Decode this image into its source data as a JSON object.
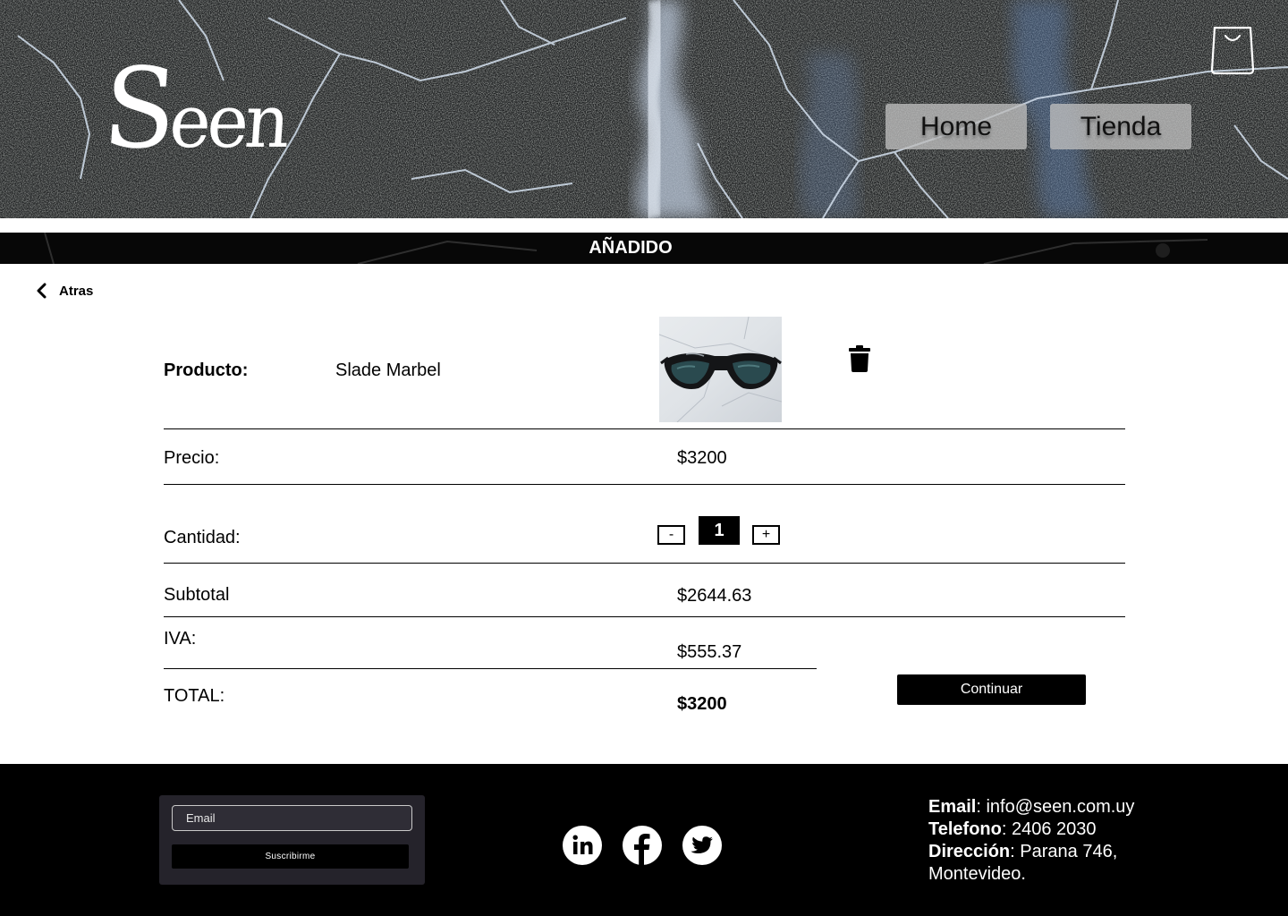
{
  "header": {
    "logo": {
      "big": "S",
      "rest": "een"
    },
    "nav": {
      "home": "Home",
      "tienda": "Tienda"
    },
    "cart_icon": "shopping-bag-icon"
  },
  "banner": {
    "text": "AÑADIDO"
  },
  "back": {
    "label": "Atras",
    "icon": "chevron-left-icon"
  },
  "cart": {
    "product_label": "Producto:",
    "product_name": "Slade Marbel",
    "product_image": "sunglasses on marble",
    "delete_icon": "trash-icon",
    "price_label": "Precio:",
    "price_value": "$3200",
    "quantity_label": "Cantidad:",
    "quantity_minus": "-",
    "quantity_value": "1",
    "quantity_plus": "+",
    "subtotal_label": "Subtotal",
    "subtotal_value": "$2644.63",
    "iva_label": "IVA:",
    "iva_value": "$555.37",
    "total_label": "TOTAL:",
    "total_value": "$3200",
    "continue_label": "Continuar"
  },
  "footer": {
    "email_placeholder": "Email",
    "subscribe_label": "Suscribirme",
    "social": [
      "linkedin-icon",
      "facebook-icon",
      "twitter-icon"
    ],
    "contact": {
      "email_label": "Email",
      "email_value": ": info@seen.com.uy",
      "phone_label": "Telefono",
      "phone_value": ": 2406 2030",
      "address_label": "Dirección",
      "address_value": ": Parana 746, Montevideo."
    }
  },
  "colors": {
    "header_bg": "#1c1e1f",
    "marble_vein": "#c8d6e8",
    "accent": "#000000",
    "footer_box": "#25232b"
  }
}
